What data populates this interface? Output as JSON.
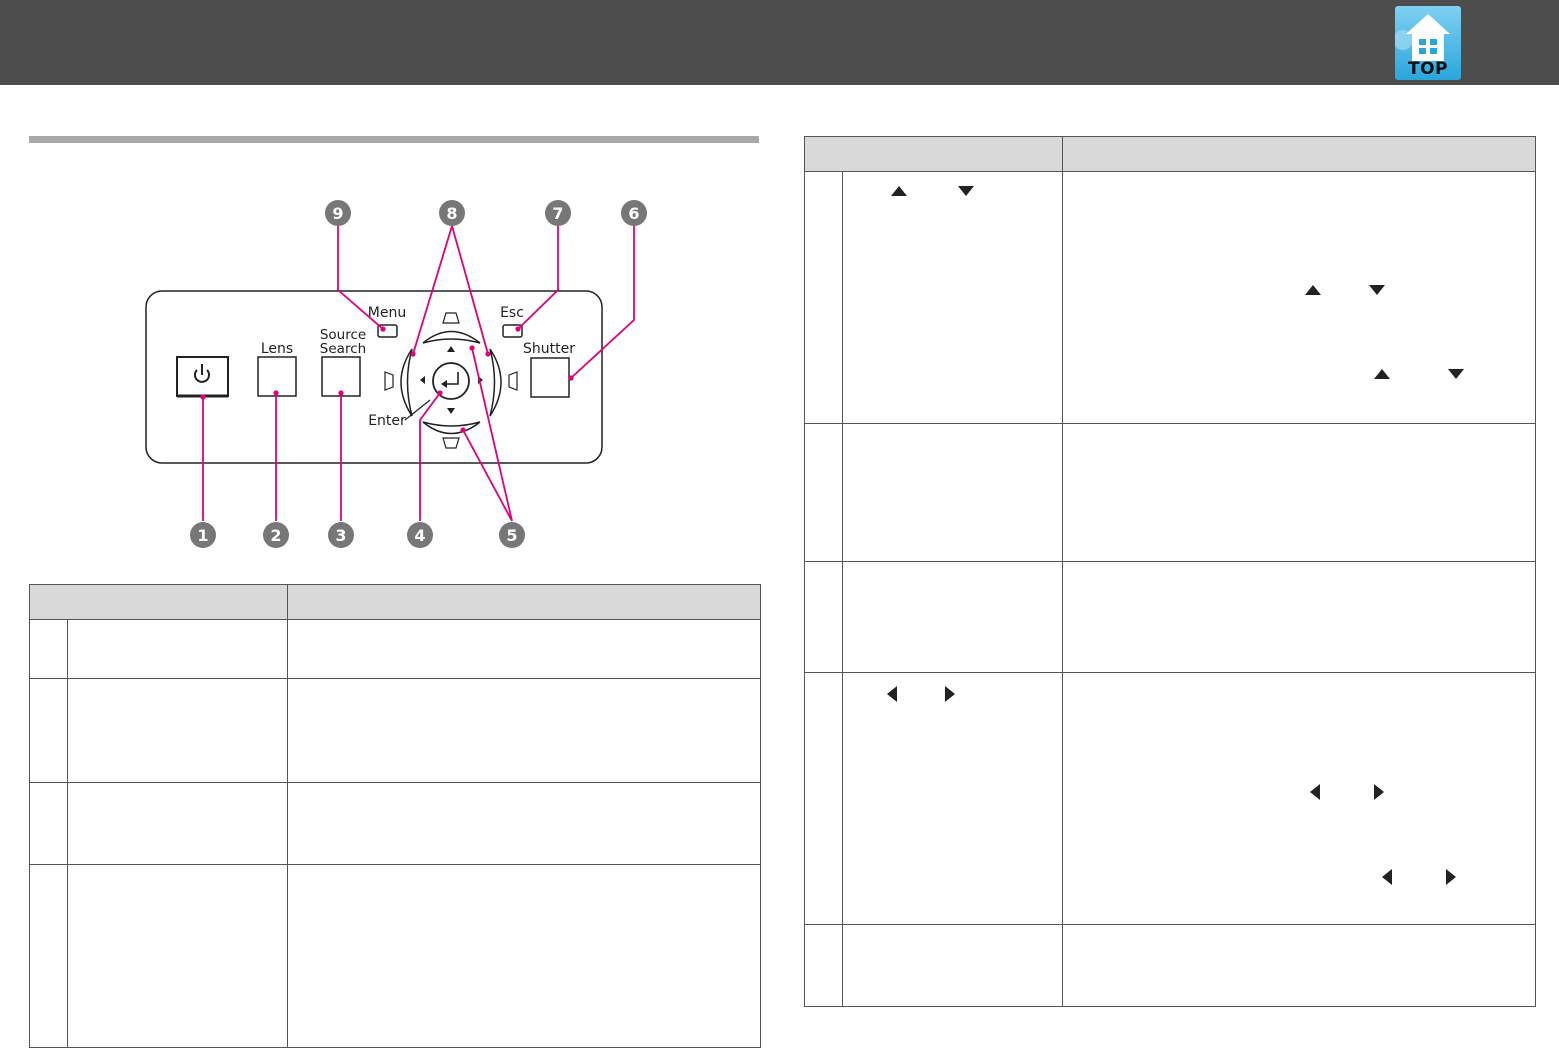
{
  "header": {
    "top_button_label": "TOP",
    "accent_color": "#2aa6dc",
    "bar_color": "#4d4d4d"
  },
  "control_panel": {
    "labels": {
      "menu": "Menu",
      "lens": "Lens",
      "source_line1": "Source",
      "source_line2": "Search",
      "esc": "Esc",
      "shutter": "Shutter",
      "enter": "Enter"
    },
    "callouts": [
      "1",
      "2",
      "3",
      "4",
      "5",
      "6",
      "7",
      "8",
      "9"
    ],
    "callout_line_color": "#e0007a"
  },
  "icons": {
    "power": "power-icon",
    "enter": "enter-icon",
    "up": "triangle-up-icon",
    "down": "triangle-down-icon",
    "left": "triangle-left-icon",
    "right": "triangle-right-icon",
    "keystone": "keystone-icon"
  }
}
